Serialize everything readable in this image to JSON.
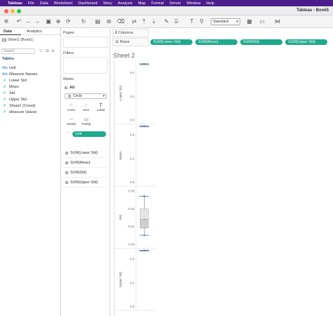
{
  "menubar": {
    "apple": "",
    "app": "Tableau",
    "items": [
      "File",
      "Data",
      "Worksheet",
      "Dashboard",
      "Story",
      "Analysis",
      "Map",
      "Format",
      "Server",
      "Window",
      "Help"
    ]
  },
  "window": {
    "title": "Tableau - Book5"
  },
  "colors": {
    "menubar": "#4b1d8c",
    "pill": "#1fa98d",
    "close": "#ff5f57",
    "minimize": "#febc2e",
    "zoom": "#28c840"
  },
  "toolbar": {
    "fit_value": "Standard"
  },
  "left_pane": {
    "tabs": [
      "Data",
      "Analytics"
    ],
    "datasource": "Sheet1 (Book1)",
    "search_placeholder": "Search",
    "tables_header": "Tables",
    "fields": [
      {
        "label": "Unit",
        "kind": "dim",
        "icon": "Abc",
        "italic": false
      },
      {
        "label": "Measure Names",
        "kind": "dim",
        "icon": "Abc",
        "italic": true
      },
      {
        "label": "Lower Std",
        "kind": "meas",
        "icon": "#",
        "italic": false
      },
      {
        "label": "Mean",
        "kind": "meas",
        "icon": "#",
        "italic": false
      },
      {
        "label": "Std",
        "kind": "meas",
        "icon": "#",
        "italic": false
      },
      {
        "label": "Upper Std",
        "kind": "meas",
        "icon": "#",
        "italic": false
      },
      {
        "label": "Sheet1 (Count)",
        "kind": "meas",
        "icon": "#",
        "italic": true
      },
      {
        "label": "Measure Values",
        "kind": "meas",
        "icon": "#",
        "italic": true
      }
    ]
  },
  "cards": {
    "pages": "Pages",
    "filters": "Filters",
    "marks": "Marks",
    "all": "All",
    "mark_type": "Circle",
    "buttons": [
      {
        "label": "Color",
        "glyph": "⁙"
      },
      {
        "label": "Size",
        "glyph": "◌"
      },
      {
        "label": "Label",
        "glyph": "T"
      },
      {
        "label": "Detail",
        "glyph": "⋯"
      },
      {
        "label": "Tooltip",
        "glyph": "▭"
      }
    ],
    "unit_pill": "Unit",
    "measure_rows": [
      "SUM(Lower Std)",
      "SUM(Mean)",
      "SUM(Std)",
      "SUM(Upper Std)"
    ]
  },
  "shelves": {
    "columns_label": "Columns",
    "rows_label": "Rows",
    "rows_pills": [
      "SUM(Lower Std)",
      "SUM(Mean)",
      "SUM(Std)",
      "SUM(Upper Std)"
    ]
  },
  "sheet": {
    "title": "Sheet 2"
  },
  "chart_data": {
    "type": "boxplot",
    "panes": [
      {
        "name": "Lower Std",
        "ticks": [
          "0.4",
          "0.2",
          "0.0"
        ],
        "ylim": [
          0.0,
          0.45
        ],
        "box": {
          "low": 0.51,
          "q1": 0.55,
          "median": 0.58,
          "q3": 0.6,
          "high": 0.63
        }
      },
      {
        "name": "Mean",
        "ticks": [
          "0.4",
          "0.2",
          "0.0"
        ],
        "ylim": [
          0.0,
          0.45
        ],
        "box": {
          "low": 0.52,
          "q1": 0.56,
          "median": 0.58,
          "q3": 0.61,
          "high": 0.64
        }
      },
      {
        "name": "Std",
        "ticks": [
          "0.03",
          "0.02",
          "0.01",
          "0.00"
        ],
        "ylim": [
          0.0,
          0.03
        ],
        "box": {
          "low": 0.005,
          "q1": 0.009,
          "median": 0.014,
          "q3": 0.02,
          "high": 0.027
        }
      },
      {
        "name": "Upper Std",
        "ticks": [
          "0.4",
          "0.2",
          "0.0"
        ],
        "ylim": [
          0.0,
          0.45
        ],
        "box": {
          "low": 0.53,
          "q1": 0.56,
          "median": 0.59,
          "q3": 0.61,
          "high": 0.63
        }
      }
    ]
  }
}
